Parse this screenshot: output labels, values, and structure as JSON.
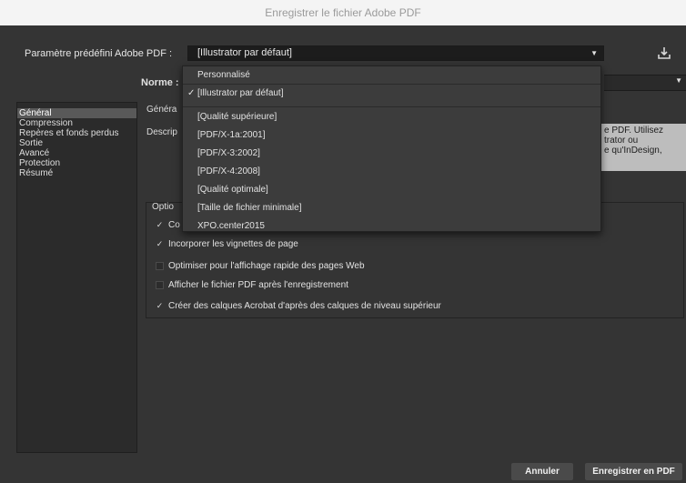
{
  "window": {
    "title": "Enregistrer le fichier Adobe PDF"
  },
  "preset": {
    "label": "Paramètre prédéfini Adobe PDF :",
    "value": "[Illustrator par défaut]",
    "save_icon": "save-preset-icon"
  },
  "norme": {
    "label": "Norme :"
  },
  "sidebar": {
    "items": [
      {
        "label": "Général",
        "selected": true
      },
      {
        "label": "Compression"
      },
      {
        "label": "Repères et fonds perdus"
      },
      {
        "label": "Sortie"
      },
      {
        "label": "Avancé"
      },
      {
        "label": "Protection"
      },
      {
        "label": "Résumé"
      }
    ]
  },
  "panel": {
    "section_label": "Généra",
    "description_label": "Descrip",
    "description_text": "e PDF. Utilisez\ntrator ou\ne qu'InDesign,",
    "options_label": "Optio"
  },
  "options": [
    {
      "label": "Co",
      "checked": true
    },
    {
      "label": "Incorporer les vignettes de page",
      "checked": true
    },
    {
      "label": "Optimiser pour l'affichage rapide des pages Web",
      "checked": false
    },
    {
      "label": "Afficher le fichier PDF après l'enregistrement",
      "checked": false
    },
    {
      "label": "Créer des calques Acrobat d'après des calques de niveau supérieur",
      "checked": true
    }
  ],
  "dropdown": {
    "items": [
      {
        "label": "Personnalisé",
        "checked": false
      },
      {
        "label": "[Illustrator par défaut]",
        "checked": true
      },
      {
        "label": "[Qualité supérieure]",
        "checked": false
      },
      {
        "label": "[PDF/X-1a:2001]",
        "checked": false
      },
      {
        "label": "[PDF/X-3:2002]",
        "checked": false
      },
      {
        "label": "[PDF/X-4:2008]",
        "checked": false
      },
      {
        "label": "[Qualité optimale]",
        "checked": false
      },
      {
        "label": "[Taille de fichier minimale]",
        "checked": false
      },
      {
        "label": "XPO.center2015",
        "checked": false
      }
    ]
  },
  "buttons": {
    "cancel": "Annuler",
    "save": "Enregistrer en PDF"
  },
  "colors": {
    "dialog_bg": "#343434",
    "selected_sidebar": "#595959",
    "dropdown_bg": "#3c3c3c"
  }
}
